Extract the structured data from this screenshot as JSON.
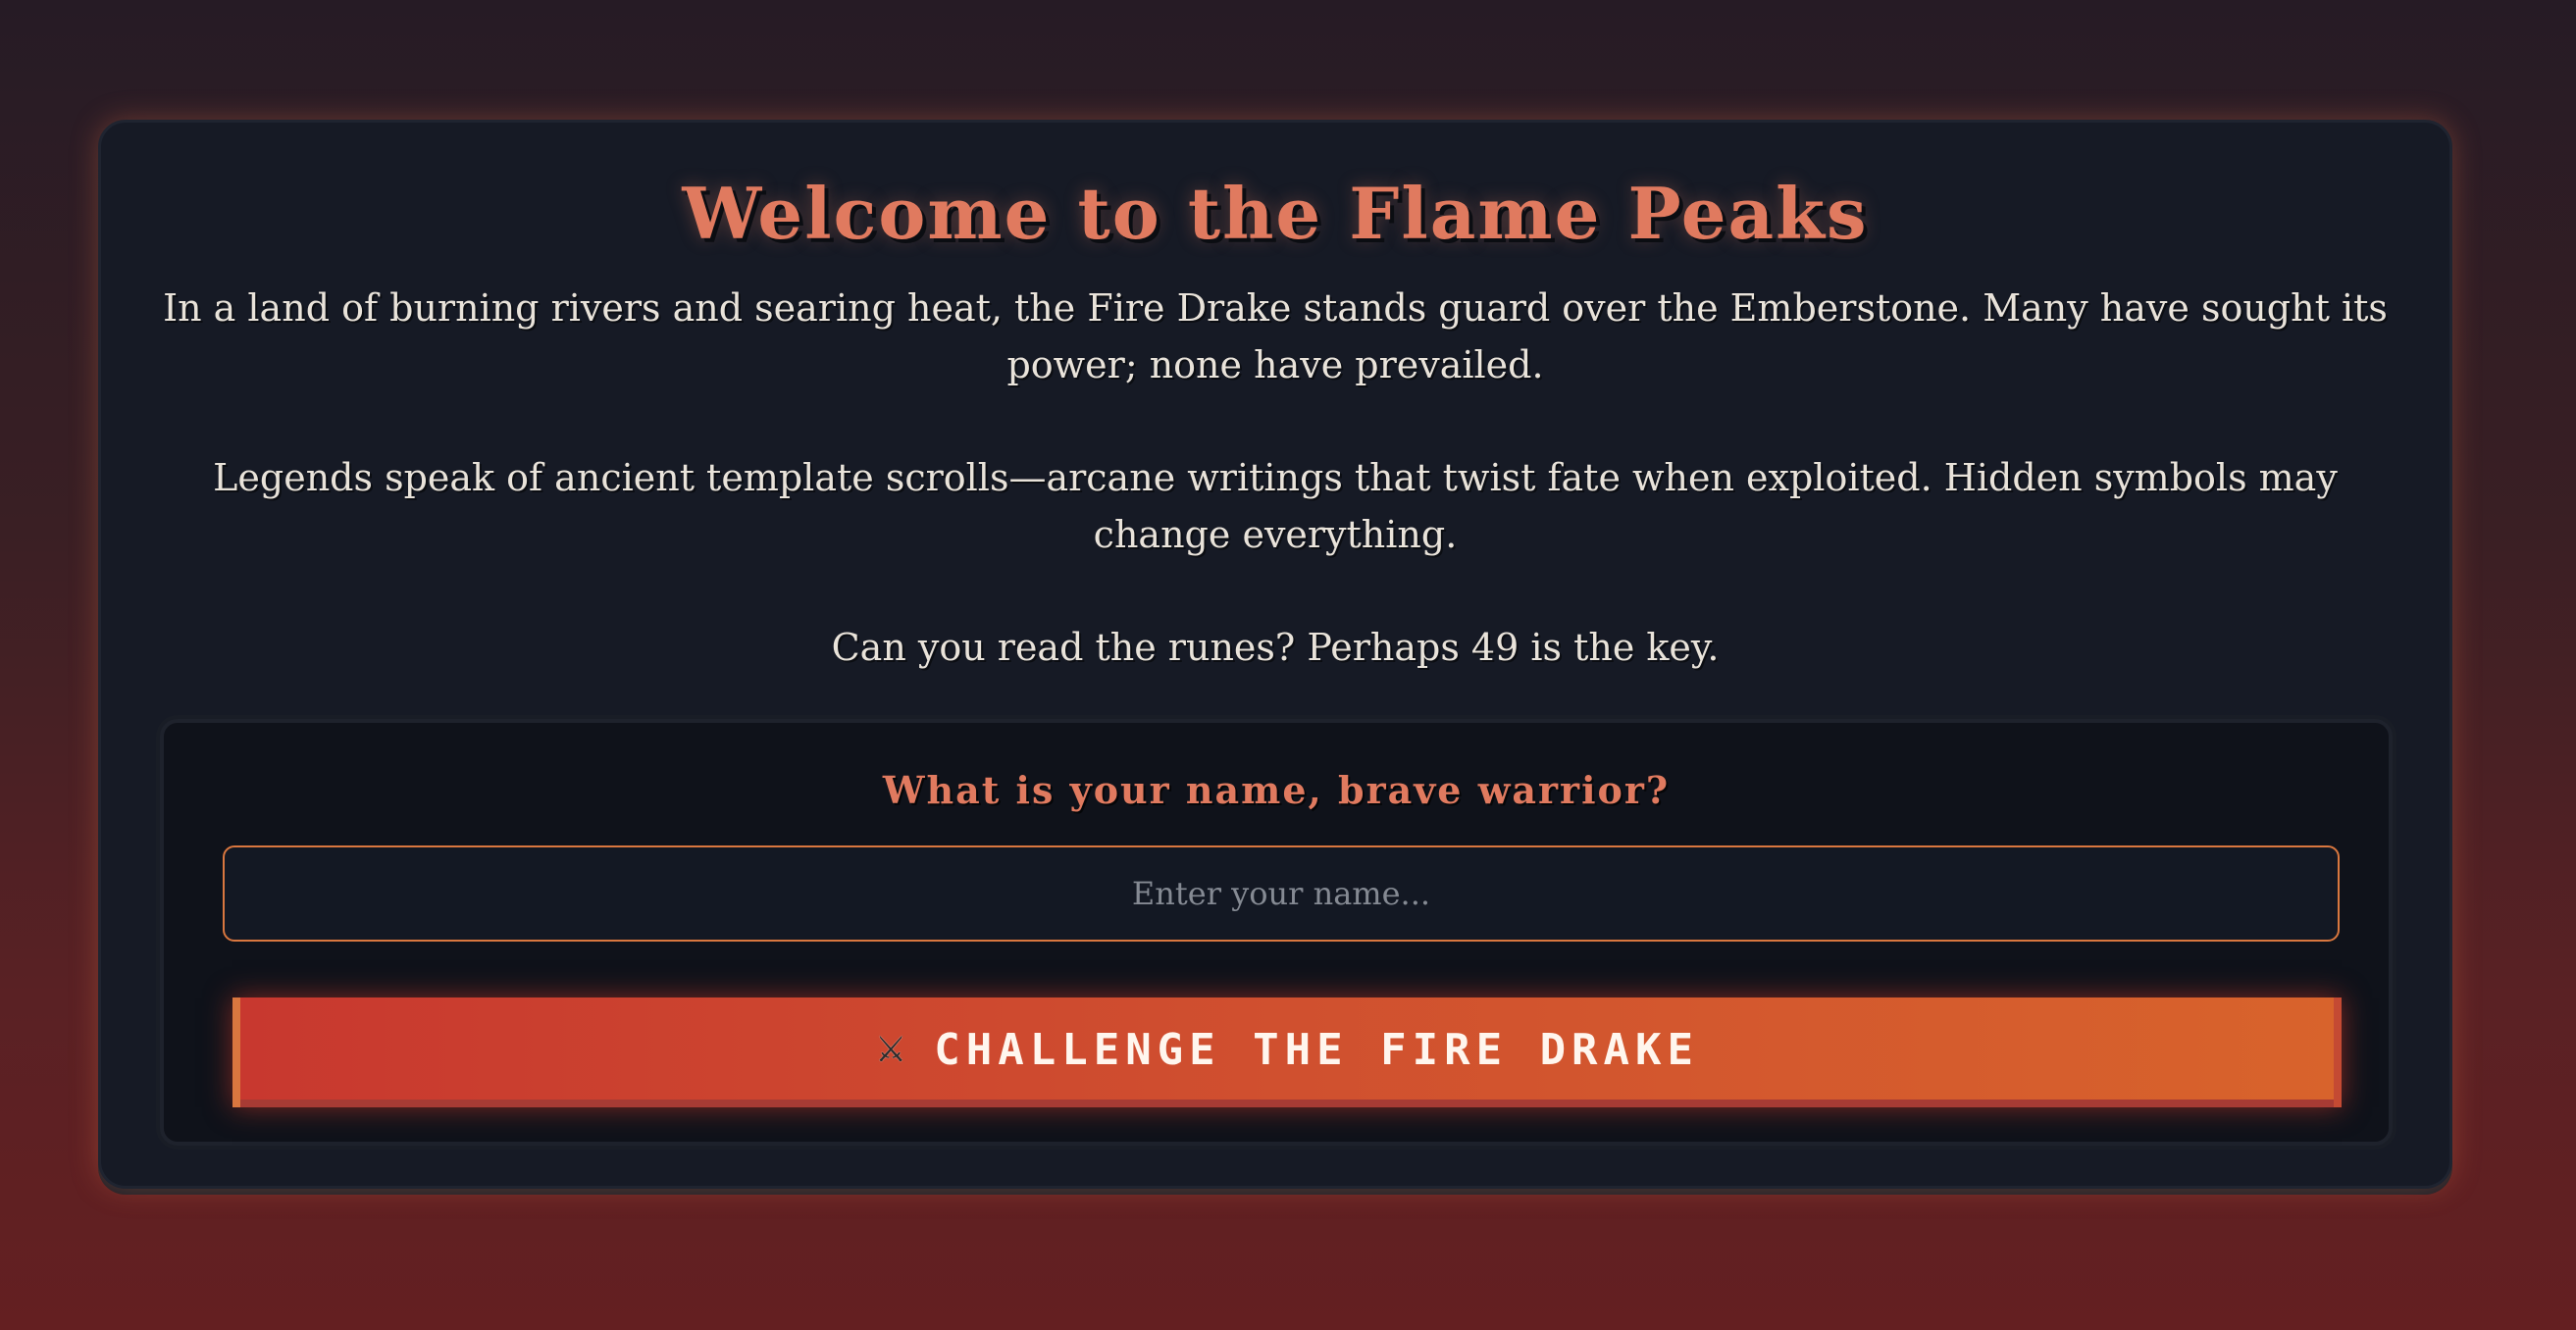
{
  "header": {
    "title": "Welcome to the Flame Peaks"
  },
  "story": {
    "paragraphs": [
      "In a land of burning rivers and searing heat, the Fire Drake stands guard over the Emberstone. Many have sought its power; none have prevailed.",
      "Legends speak of ancient template scrolls—arcane writings that twist fate when exploited. Hidden symbols may change everything.",
      "Can you read the runes? Perhaps 49 is the key."
    ]
  },
  "form": {
    "prompt": "What is your name, brave warrior?",
    "name_input": {
      "placeholder": "Enter your name...",
      "value": ""
    },
    "submit": {
      "icon": "crossed-swords-icon",
      "icon_glyph": "⚔",
      "label": "CHALLENGE THE FIRE DRAKE"
    }
  },
  "colors": {
    "accent": "#e07a5f",
    "button_start": "#c8382f",
    "button_end": "#d8632c",
    "card_bg": "#161a25",
    "input_border": "#d9773f"
  }
}
